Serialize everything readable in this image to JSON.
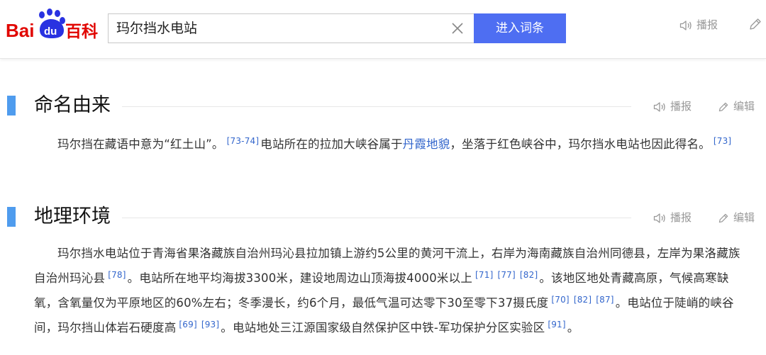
{
  "header": {
    "logo_bai": "Bai",
    "logo_du": "du",
    "logo_baike": "百科",
    "search_value": "玛尔挡水电站",
    "search_button": "进入词条",
    "tools": {
      "broadcast": "播报"
    }
  },
  "colors": {
    "brand_blue": "#4e6ef2",
    "logo_red": "#e10601",
    "logo_blue": "#2932e1",
    "section_bar": "#4f9cee",
    "link": "#3366cc"
  },
  "icons": [
    "speaker-icon",
    "pencil-icon",
    "clear-icon",
    "baidu-paw-icon"
  ],
  "sections": [
    {
      "title": "命名由来",
      "tools": {
        "broadcast": "播报",
        "edit": "编辑"
      },
      "paragraph": [
        {
          "t": "text",
          "v": "玛尔挡在藏语中意为“红土山”。"
        },
        {
          "t": "ref",
          "v": "[73-74]"
        },
        {
          "t": "text",
          "v": "电站所在的拉加大峡谷属于"
        },
        {
          "t": "link",
          "v": "丹霞地貌"
        },
        {
          "t": "text",
          "v": "，坐落于红色峡谷中，玛尔挡水电站也因此得名。"
        },
        {
          "t": "ref",
          "v": "[73]"
        }
      ]
    },
    {
      "title": "地理环境",
      "tools": {
        "broadcast": "播报",
        "edit": "编辑"
      },
      "paragraph": [
        {
          "t": "text",
          "v": "玛尔挡水电站位于青海省果洛藏族自治州玛沁县拉加镇上游约5公里的黄河干流上，右岸为海南藏族自治州同德县，左岸为果洛藏族自治州玛沁县"
        },
        {
          "t": "ref",
          "v": "[78]"
        },
        {
          "t": "text",
          "v": "。电站所在地平均海拔3300米，建设地周边山顶海拔4000米以上"
        },
        {
          "t": "ref",
          "v": "[71]"
        },
        {
          "t": "ref",
          "v": "[77]"
        },
        {
          "t": "ref",
          "v": "[82]"
        },
        {
          "t": "text",
          "v": "。该地区地处青藏高原，气候高寒缺氧，含氧量仅为平原地区的60%左右；冬季漫长，约6个月，最低气温可达零下30至零下37摄氏度"
        },
        {
          "t": "ref",
          "v": "[70]"
        },
        {
          "t": "ref",
          "v": "[82]"
        },
        {
          "t": "ref",
          "v": "[87]"
        },
        {
          "t": "text",
          "v": "。电站位于陡峭的峡谷间，玛尔挡山体岩石硬度高"
        },
        {
          "t": "ref",
          "v": "[69]"
        },
        {
          "t": "ref",
          "v": "[93]"
        },
        {
          "t": "text",
          "v": "。电站地处三江源国家级自然保护区中铁-军功保护分区实验区"
        },
        {
          "t": "ref",
          "v": "[91]"
        },
        {
          "t": "text",
          "v": "。"
        }
      ]
    }
  ]
}
